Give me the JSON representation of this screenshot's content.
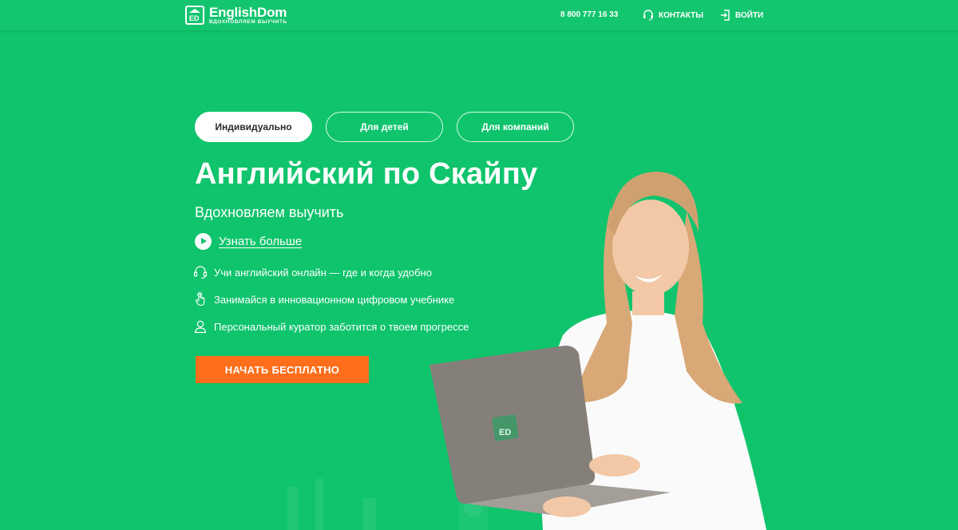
{
  "header": {
    "logo_brand": "EnglishDom",
    "logo_tagline": "ВДОХНОВЛЯЕМ ВЫУЧИТЬ",
    "logo_mark": "ED",
    "phone": "8 800 777 16 33",
    "contacts_label": "КОНТАКТЫ",
    "contacts_icon": "headset-icon",
    "login_label": "ВОЙТИ",
    "login_icon": "login-icon"
  },
  "tabs": [
    {
      "label": "Индивидуально",
      "active": true
    },
    {
      "label": "Для детей",
      "active": false
    },
    {
      "label": "Для компаний",
      "active": false
    }
  ],
  "hero": {
    "title": "Английский по Скайпу",
    "subtitle": "Вдохновляем выучить",
    "learn_more": "Узнать больше",
    "features": [
      {
        "icon": "headset-icon",
        "text": "Учи английский онлайн — где и когда удобно"
      },
      {
        "icon": "touch-hand-icon",
        "text": "Занимайся в инновационном цифровом учебнике"
      },
      {
        "icon": "person-icon",
        "text": "Персональный куратор заботится о твоем прогрессе"
      }
    ],
    "cta": "НАЧАТЬ БЕСПЛАТНО",
    "laptop_logo": "ED"
  },
  "colors": {
    "background": "#0fc46c",
    "cta": "#ff6e1a",
    "text": "#ffffff",
    "tab_active_text": "#2b2b2b"
  }
}
